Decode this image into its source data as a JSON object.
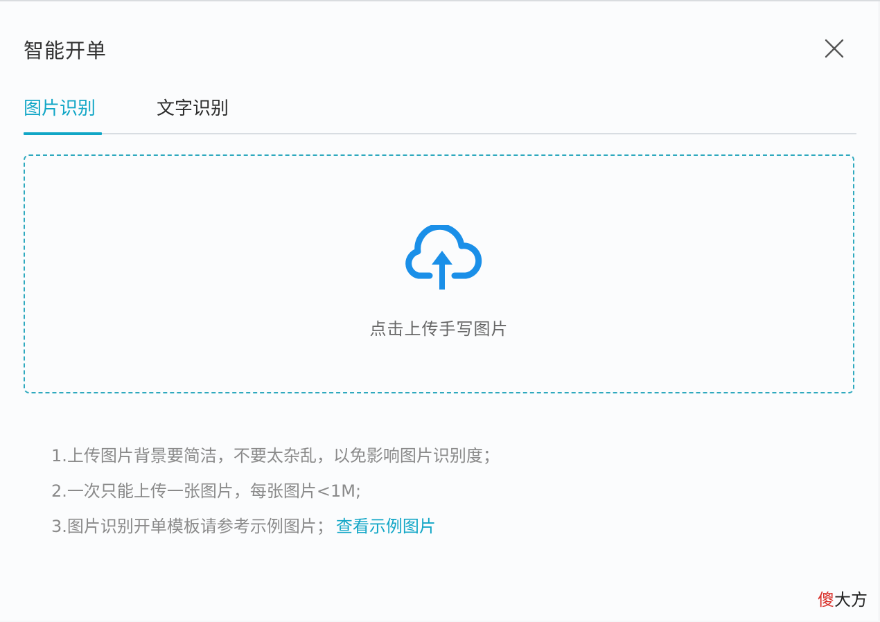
{
  "dialog": {
    "title": "智能开单"
  },
  "tabs": [
    {
      "label": "图片识别",
      "active": true
    },
    {
      "label": "文字识别",
      "active": false
    }
  ],
  "upload": {
    "icon": "cloud-upload-icon",
    "label": "点击上传手写图片"
  },
  "tips": {
    "tip1": "1.上传图片背景要简洁，不要太杂乱，以免影响图片识别度；",
    "tip2": "2.一次只能上传一张图片，每张图片<1M;",
    "tip3": "3.图片识别开单模板请参考示例图片；",
    "tip3_link": "查看示例图片"
  },
  "watermark": {
    "char1": "傻",
    "rest": "大方"
  },
  "colors": {
    "accent": "#11a6c6",
    "upload_icon": "#1a8fe8",
    "dashed_border": "#2ea9be",
    "watermark_red": "#d9302a"
  }
}
